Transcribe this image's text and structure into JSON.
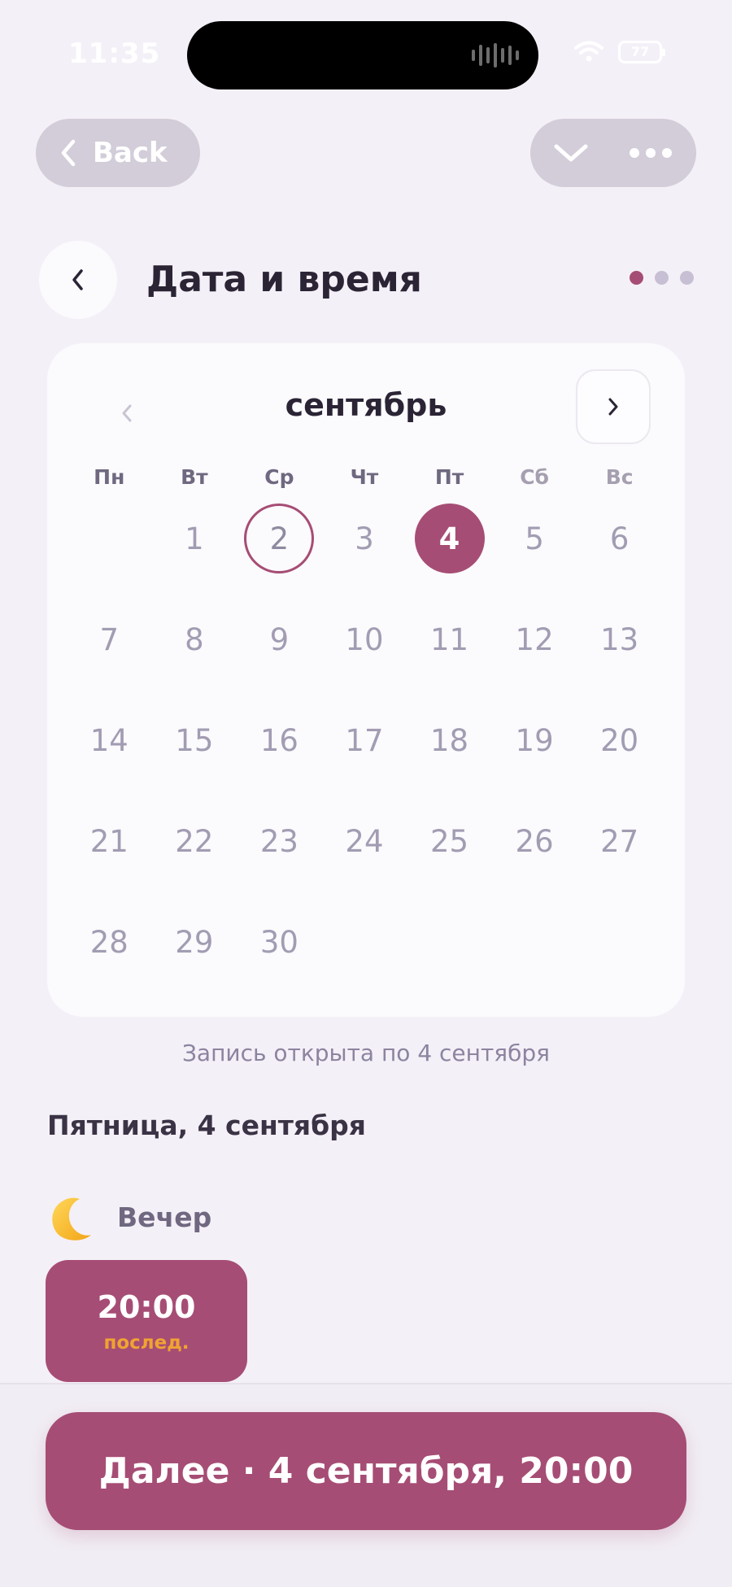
{
  "status": {
    "time": "11:35",
    "battery": "77"
  },
  "topbar": {
    "back_label": "Back"
  },
  "header": {
    "title": "Дата и время",
    "steps_total": 3,
    "steps_active": 1
  },
  "calendar": {
    "month": "сентябрь",
    "weekdays": [
      "Пн",
      "Вт",
      "Ср",
      "Чт",
      "Пт",
      "Сб",
      "Вс"
    ],
    "weeks": [
      [
        "",
        "1",
        "2",
        "3",
        "4",
        "5",
        "6"
      ],
      [
        "7",
        "8",
        "9",
        "10",
        "11",
        "12",
        "13"
      ],
      [
        "14",
        "15",
        "16",
        "17",
        "18",
        "19",
        "20"
      ],
      [
        "21",
        "22",
        "23",
        "24",
        "25",
        "26",
        "27"
      ],
      [
        "28",
        "29",
        "30",
        "",
        "",
        "",
        ""
      ]
    ],
    "today": "2",
    "selected": "4"
  },
  "booking_note": "Запись открыта по 4 сентября",
  "day_heading": "Пятница, 4 сентября",
  "period": {
    "label": "Вечер",
    "icon": "crescent-moon-icon"
  },
  "slots": [
    {
      "time": "20:00",
      "tag": "послед."
    }
  ],
  "next_button": {
    "label": "Далее · 4 сентября, 20:00"
  },
  "colors": {
    "accent": "#a64d75",
    "tag": "#f0a331",
    "background": "#f4f0f7"
  }
}
